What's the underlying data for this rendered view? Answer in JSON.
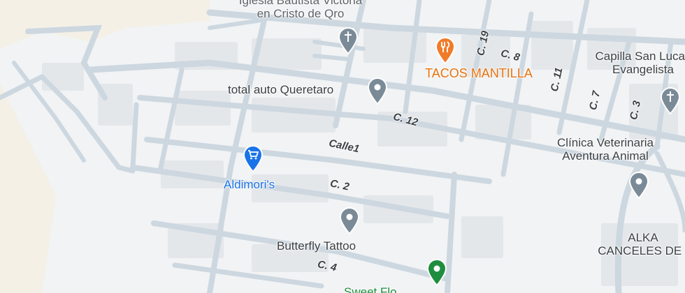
{
  "colors": {
    "land": "#f1f3f4",
    "sand": "#f5f0e6",
    "road": "#cdd7e0",
    "block": "#e3e6e9",
    "poi_gray": "#7b8a97",
    "restaurant": "#f07b29",
    "shopping": "#1a73e8",
    "green_pin": "#1e8e3e"
  },
  "pois": {
    "iglesia": {
      "line1": "Iglesia Bautista Victoria",
      "line2": "en Cristo de Qro",
      "icon": "church-icon"
    },
    "tacos": {
      "label": "TACOS MANTILLA",
      "icon": "restaurant-icon"
    },
    "capilla": {
      "line1": "Capilla San Lucas",
      "line2": "Evangelista",
      "icon": "church-icon"
    },
    "total_auto": {
      "label": "total auto Queretaro",
      "icon": "place-icon"
    },
    "clinica": {
      "line1": "Clínica Veterinaria",
      "line2": "Aventura Animal",
      "icon": "place-icon"
    },
    "aldimori": {
      "label": "Aldimori's",
      "icon": "shopping-cart-icon"
    },
    "butterfly": {
      "label": "Butterfly Tattoo",
      "icon": "place-icon"
    },
    "alka": {
      "line1": "ALKA",
      "line2": "CANCELES DE I"
    },
    "bottom_green": {
      "label": "Sweet Flo",
      "icon": "place-icon"
    }
  },
  "streets": {
    "c19": "C. 19",
    "c8": "C. 8",
    "c11": "C. 11",
    "c7": "C. 7",
    "c3": "C. 3",
    "c12": "C. 12",
    "calle1": "Calle1",
    "c2": "C. 2",
    "c4": "C. 4"
  }
}
